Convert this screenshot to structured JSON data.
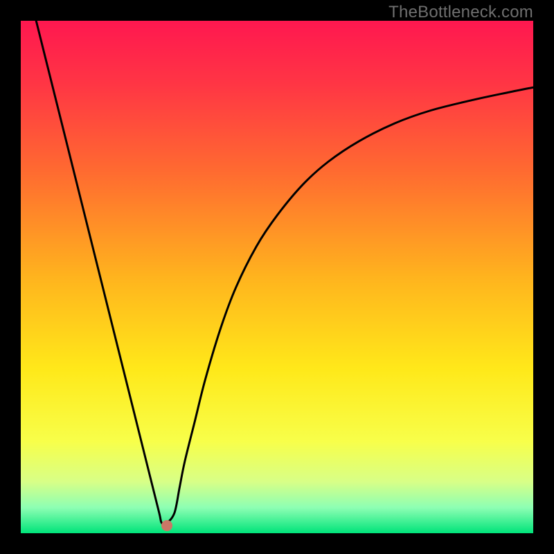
{
  "watermark": "TheBottleneck.com",
  "chart_data": {
    "type": "line",
    "title": "",
    "xlabel": "",
    "ylabel": "",
    "xlim": [
      0,
      100
    ],
    "ylim": [
      0,
      100
    ],
    "grid": false,
    "background_gradient": {
      "stops": [
        {
          "pos": 0.0,
          "color": "#ff1850"
        },
        {
          "pos": 0.12,
          "color": "#ff3545"
        },
        {
          "pos": 0.3,
          "color": "#ff6d30"
        },
        {
          "pos": 0.5,
          "color": "#ffb41e"
        },
        {
          "pos": 0.68,
          "color": "#ffe91a"
        },
        {
          "pos": 0.82,
          "color": "#f8ff4a"
        },
        {
          "pos": 0.9,
          "color": "#d8ff88"
        },
        {
          "pos": 0.95,
          "color": "#8effb4"
        },
        {
          "pos": 1.0,
          "color": "#00e47a"
        }
      ]
    },
    "series": [
      {
        "name": "bottleneck-curve",
        "color": "#000000",
        "x": [
          3,
          5,
          8,
          10,
          13,
          16,
          19,
          22,
          25,
          27,
          27.5,
          28.5,
          30,
          31,
          32,
          34,
          36,
          39,
          42,
          46,
          50,
          55,
          60,
          66,
          73,
          80,
          88,
          95,
          100
        ],
        "y": [
          100,
          92,
          80,
          72,
          60,
          48,
          36,
          24,
          12,
          4,
          2,
          2,
          4,
          9,
          14,
          22,
          30,
          40,
          48,
          56,
          62,
          68,
          72.5,
          76.5,
          80,
          82.5,
          84.5,
          86,
          87
        ]
      }
    ],
    "marker": {
      "x": 28.5,
      "y": 1.5,
      "color": "#c97766"
    }
  }
}
